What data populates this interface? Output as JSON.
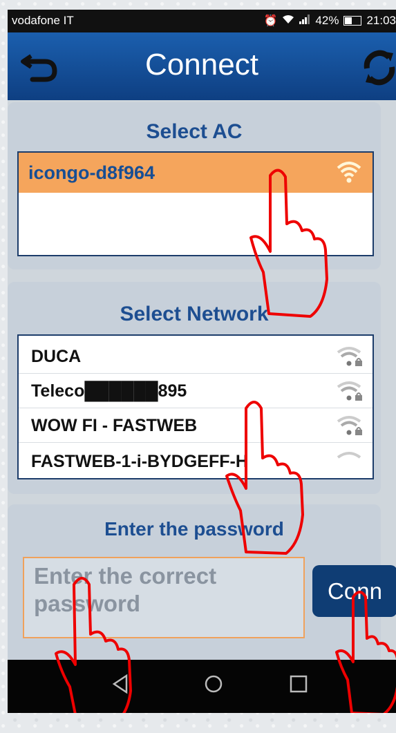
{
  "status_bar": {
    "carrier": "vodafone IT",
    "battery": "42%",
    "time": "21:03",
    "icons": [
      "alarm-icon",
      "wifi-icon",
      "signal-icon",
      "battery-icon"
    ]
  },
  "header": {
    "title": "Connect",
    "back_icon": "back-arrow-icon",
    "refresh_icon": "refresh-icon",
    "color": "#1b5fae"
  },
  "select_ac": {
    "heading": "Select AC",
    "items": [
      {
        "name": "icongo-d8f964",
        "selected": true,
        "icon": "wifi-icon"
      }
    ],
    "selected_color": "#f5a55c"
  },
  "select_network": {
    "heading": "Select Network",
    "items": [
      {
        "name": "DUCA",
        "icon": "wifi-locked-icon"
      },
      {
        "name": "Teleco██████895",
        "icon": "wifi-locked-icon"
      },
      {
        "name": "WOW FI - FASTWEB",
        "icon": "wifi-locked-icon"
      },
      {
        "name": "FASTWEB-1-i-BYDGEFF-H",
        "icon": "wifi-locked-icon"
      }
    ]
  },
  "password": {
    "heading": "Enter the password",
    "placeholder": "Enter the correct password",
    "connect_label": "Conn"
  },
  "nav_bar": {
    "back": "◁",
    "home": "○",
    "recents": "□"
  }
}
